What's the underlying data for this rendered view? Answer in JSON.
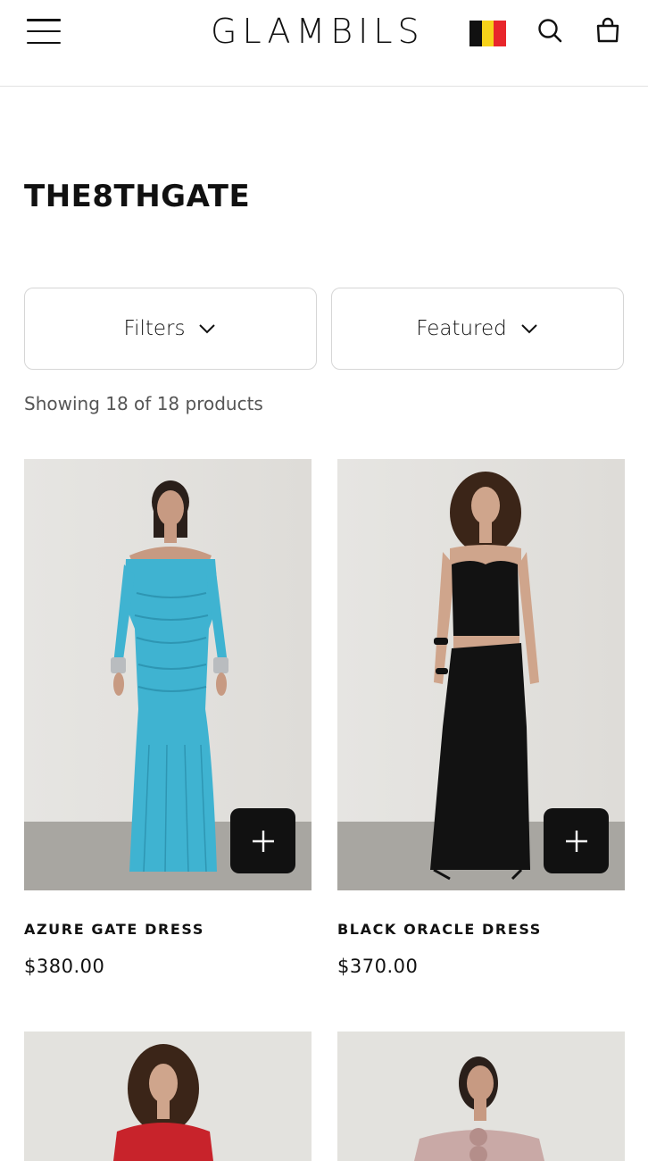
{
  "header": {
    "logo": "GLAMBILS",
    "menu_icon": "hamburger-menu-icon",
    "flag_colors": [
      "#111111",
      "#f6d21a",
      "#e8262b"
    ],
    "search_icon": "search-icon",
    "bag_icon": "shopping-bag-icon"
  },
  "page": {
    "title": "THE8THGATE",
    "filters_label": "Filters",
    "sort_label": "Featured",
    "product_count": "Showing 18 of 18 products"
  },
  "products": [
    {
      "name": "AZURE GATE DRESS",
      "price": "$380.00",
      "dress_color": "#3fb3d1",
      "add_icon": "plus-icon"
    },
    {
      "name": "BLACK ORACLE DRESS",
      "price": "$370.00",
      "dress_color": "#121212",
      "add_icon": "plus-icon"
    },
    {
      "dress_color": "#c8232b"
    },
    {
      "dress_color": "#c9a9a6"
    }
  ]
}
